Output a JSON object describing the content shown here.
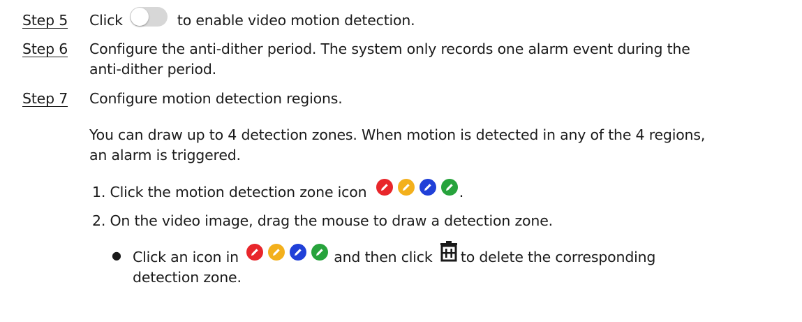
{
  "steps": [
    {
      "label": "Step 5",
      "text_before": "Click",
      "text_after": "to enable video motion detection."
    },
    {
      "label": "Step 6",
      "line1": "Configure the anti-dither period. The system only records one alarm event during the",
      "line2": "anti-dither period."
    },
    {
      "label": "Step 7",
      "line1": "Configure motion detection regions.",
      "para_line1": "You can draw up to 4 detection zones. When motion is detected in any of the 4 regions,",
      "para_line2": "an alarm is triggered."
    }
  ],
  "substeps": [
    {
      "number": "1.",
      "text": "Click the motion detection zone icon",
      "suffix": "."
    },
    {
      "number": "2.",
      "text": "On the video image, drag the mouse to draw a detection zone."
    }
  ],
  "bullet": {
    "symbol": "●",
    "before": "Click an icon in",
    "middle": "and then click",
    "after": "to delete the corresponding",
    "line2": "detection zone."
  },
  "icons": {
    "toggle": "toggle-switch-off-icon",
    "zones": [
      "red-pencil-icon",
      "yellow-pencil-icon",
      "blue-pencil-icon",
      "green-pencil-icon"
    ],
    "delete": "trash-icon"
  },
  "colors": {
    "zone_red": "#e8262b",
    "zone_yellow": "#f3b01c",
    "zone_blue": "#2040d8",
    "zone_green": "#27a33c",
    "toggle_track": "#d7d7d7"
  }
}
